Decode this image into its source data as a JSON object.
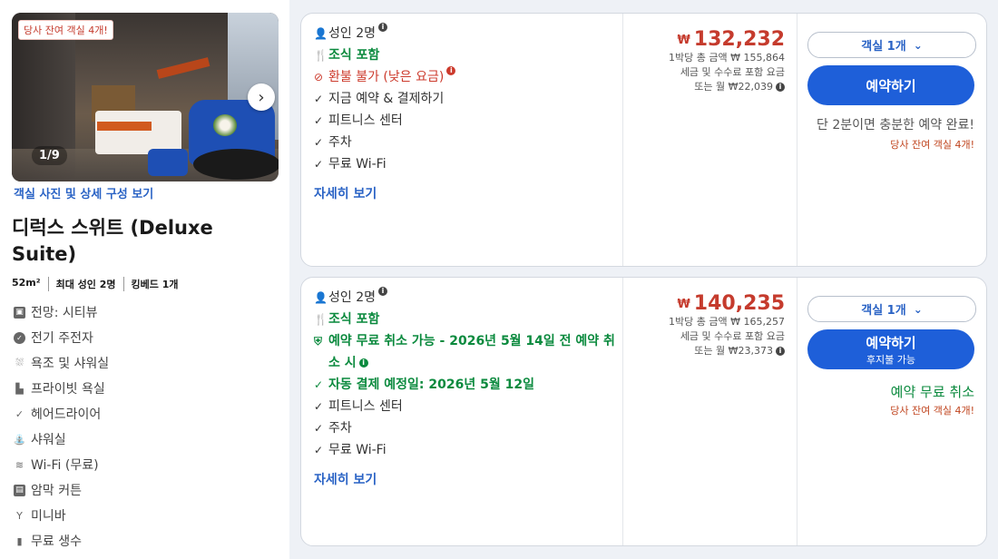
{
  "room": {
    "photo_badge": "당사 잔여 객실 4개!",
    "photo_counter": "1/9",
    "photo_link": "객실 사진 및 상세 구성 보기",
    "title": "디럭스 스위트 (Deluxe Suite)",
    "specs": [
      "52m²",
      "최대 성인 2명",
      "킹베드 1개"
    ],
    "amenities": [
      {
        "icon": "view-icon",
        "label": "전망: 시티뷰"
      },
      {
        "icon": "kettle-icon",
        "label": "전기 주전자"
      },
      {
        "icon": "bathtub-icon",
        "label": "욕조 및 샤워실"
      },
      {
        "icon": "toilet-icon",
        "label": "프라이빗 욕실"
      },
      {
        "icon": "check-icon",
        "label": "헤어드라이어"
      },
      {
        "icon": "shower-icon",
        "label": "샤워실"
      },
      {
        "icon": "wifi-icon",
        "label": "Wi-Fi (무료)"
      },
      {
        "icon": "curtain-icon",
        "label": "암막 커튼"
      },
      {
        "icon": "minibar-icon",
        "label": "미니바"
      },
      {
        "icon": "water-bottle-icon",
        "label": "무료 생수"
      }
    ]
  },
  "offers": [
    {
      "guests": "성인 2명",
      "breakfast": "조식 포함",
      "refund": "환불 불가 (낮은 요금)",
      "features": [
        "지금 예약 & 결제하기",
        "피트니스 센터",
        "주차",
        "무료 Wi-Fi"
      ],
      "more_link": "자세히 보기",
      "price": "132,232",
      "per_night": "1박당 총 금액 ₩ 155,864",
      "incl_tax": "세금 및 수수료 포함 요금",
      "monthly": "또는 월 ₩22,039",
      "room_select": "객실 1개",
      "book": "예약하기",
      "msg": "단 2분이면 충분한 예약 완료!",
      "left": "당사 잔여 객실 4개!"
    },
    {
      "guests": "성인 2명",
      "breakfast": "조식 포함",
      "free_cancel": "예약 무료 취소 가능 - 2026년 5월 14일 전 예약 취소 시",
      "auto_pay": "자동 결제 예정일: 2026년 5월 12일",
      "features": [
        "피트니스 센터",
        "주차",
        "무료 Wi-Fi"
      ],
      "more_link": "자세히 보기",
      "price": "140,235",
      "per_night": "1박당 총 금액 ₩ 165,257",
      "incl_tax": "세금 및 수수료 포함 요금",
      "monthly": "또는 월 ₩23,373",
      "room_select": "객실 1개",
      "book": "예약하기",
      "book_sub": "후지불 가능",
      "msg": "예약 무료 취소",
      "left": "당사 잔여 객실 4개!"
    }
  ],
  "currency_symbol": "₩"
}
